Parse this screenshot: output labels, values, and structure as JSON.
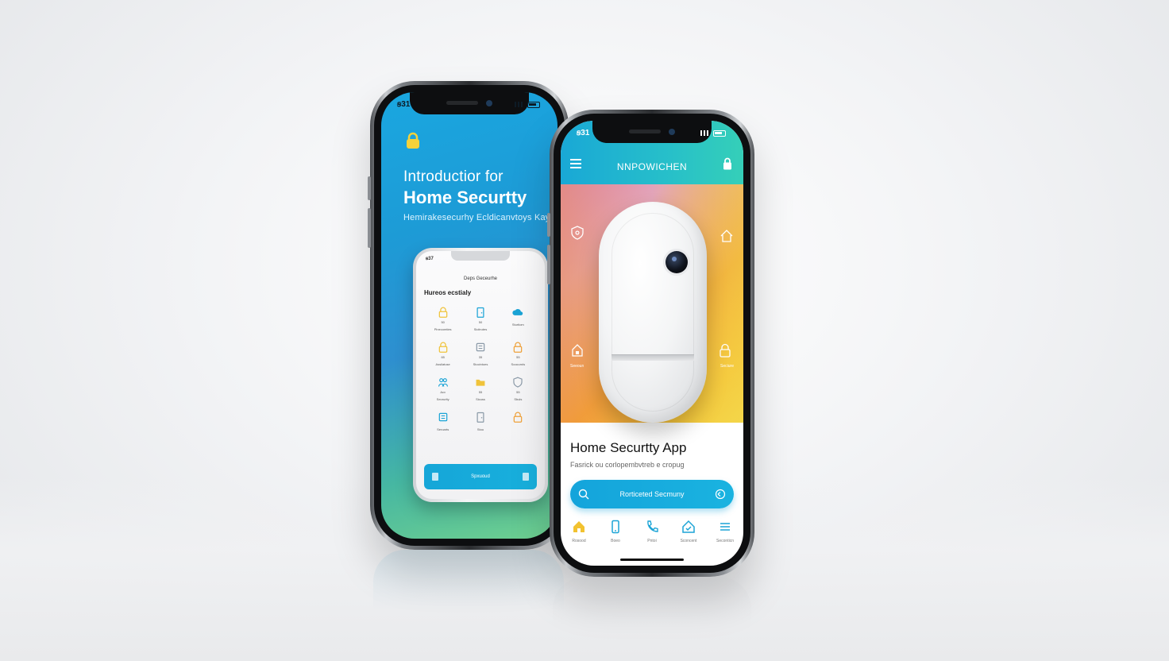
{
  "phone_left": {
    "status_time": "ꞩ31",
    "intro_line": "Introductior for",
    "title": "Home Securtty",
    "subtitle": "Hemirakesecurhy Ecldicanvtoys Kay",
    "mini_phone": {
      "status_time": "ꞩ37",
      "top_title": "Deps Geceurhe",
      "heading": "Hureos ecstialy",
      "grid_items": [
        {
          "icon": "lock-icon",
          "caption": "Pinecomties",
          "value": "50",
          "color": "#f0c33a"
        },
        {
          "icon": "door-icon",
          "caption": "Sicitrutes",
          "value": "50",
          "color": "#1ba4d6"
        },
        {
          "icon": "cloud-icon",
          "caption": "Sturtiom",
          "value": "",
          "color": "#1ba4d6"
        },
        {
          "icon": "lock-icon",
          "caption": "Assilatuse",
          "value": "65",
          "color": "#f0c33a"
        },
        {
          "icon": "panel-icon",
          "caption": "Stocintoes",
          "value": "35",
          "color": "#8b9aa8"
        },
        {
          "icon": "lock-icon",
          "caption": "Scocurnls",
          "value": "55",
          "color": "#f0a23a"
        },
        {
          "icon": "people-icon",
          "caption": "Seorurity",
          "value": "Acv",
          "color": "#1ba4d6"
        },
        {
          "icon": "folder-icon",
          "caption": "Sicuss",
          "value": "55",
          "color": "#f0c33a"
        },
        {
          "icon": "shield-icon",
          "caption": "Sbuls",
          "value": "55",
          "color": "#8b9aa8"
        },
        {
          "icon": "panel-icon",
          "caption": "Seroarts",
          "value": "",
          "color": "#1ba4d6"
        },
        {
          "icon": "door-icon",
          "caption": "Stou",
          "value": "",
          "color": "#8b9aa8"
        },
        {
          "icon": "lock-icon",
          "caption": "",
          "value": "",
          "color": "#f0a23a"
        }
      ],
      "bottom_label": "Spxuoud"
    }
  },
  "phone_right": {
    "status_time": "ꞩ31",
    "app_title": "NNPOWICHEN",
    "hero_left_caption": "Seeoun",
    "hero_right_caption": "Seciure",
    "heading": "Home Securtty App",
    "subheading": "Fasrick ou corlopembvtreb e cropug",
    "cta_label": "Rorticeted Secmuny",
    "tabs": [
      {
        "icon": "home-icon",
        "label": "Rosood",
        "color": "#f2c230"
      },
      {
        "icon": "phone-icon",
        "label": "Boeo",
        "color": "#1ba4d6"
      },
      {
        "icon": "call-icon",
        "label": "Pntoi",
        "color": "#1ba4d6"
      },
      {
        "icon": "house-check-icon",
        "label": "Sconcent",
        "color": "#1ba4d6"
      },
      {
        "icon": "menu-lines-icon",
        "label": "Seconticn",
        "color": "#1ba4d6"
      }
    ]
  },
  "colors": {
    "accent_blue": "#1ba4d6",
    "accent_teal": "#35cfb8",
    "accent_yellow": "#f2c230",
    "accent_orange": "#f2a43b"
  }
}
